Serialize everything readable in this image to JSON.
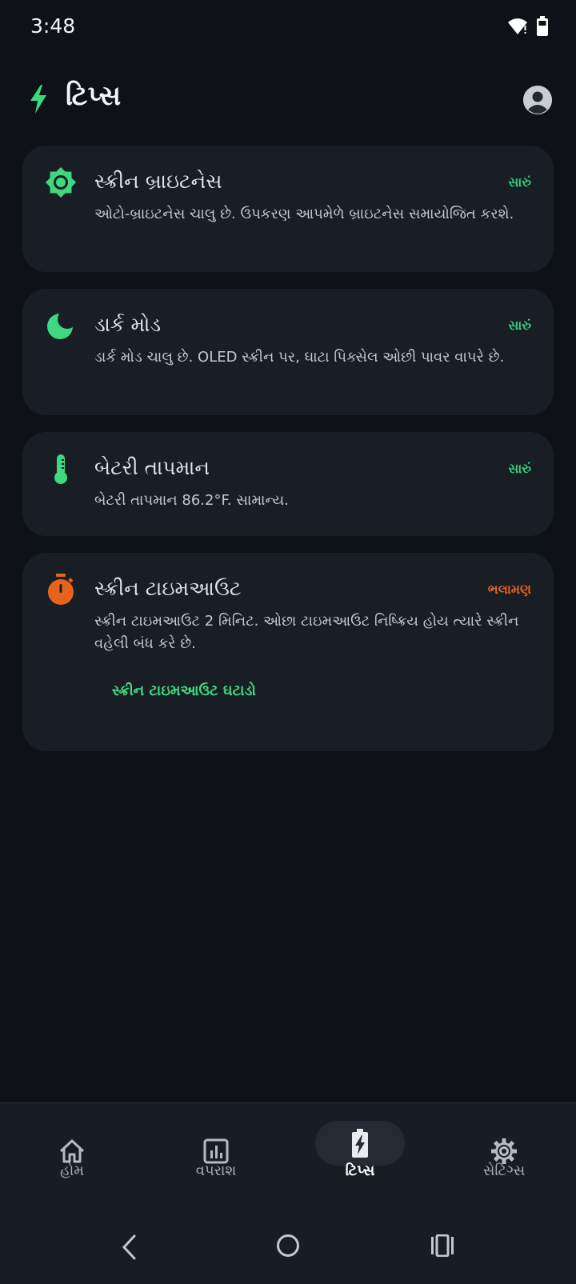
{
  "status_bar": {
    "time": "3:48",
    "icons": [
      "wifi-icon",
      "battery-icon"
    ]
  },
  "header": {
    "title": "ટિપ્સ",
    "icon": "bolt-icon",
    "profile_icon": "account-icon"
  },
  "tips": [
    {
      "icon": "brightness-icon",
      "title": "સ્ક્રીન બ્રાઇટનેસ",
      "badge": "સારું",
      "description": "ઓટો-બ્રાઇટનેસ ચાલુ છે. ઉપકરણ આપમેળે બ્રાઇટનેસ સમાયોજિત કરશે."
    },
    {
      "icon": "moon-icon",
      "title": "ડાર્ક મોડ",
      "badge": "સારું",
      "description": "ડાર્ક મોડ ચાલુ છે. OLED સ્ક્રીન પર, ઘાટા પિક્સેલ ઓછી પાવર વાપરે છે."
    },
    {
      "icon": "thermometer-icon",
      "title": "બેટરી તાપમાન",
      "badge": "સારું",
      "description": "બેટરી તાપમાન 86.2°F. સામાન્ય."
    },
    {
      "icon": "timer-icon",
      "title": "સ્ક્રીન ટાઇમઆઉટ",
      "badge": "ભલામણ",
      "description": "સ્ક્રીન ટાઇમઆઉટ 2 મિનિટ. ઓછા ટાઇમઆઉટ નિષ્ક્રિય હોય ત્યારે સ્ક્રીન વહેલી બંધ કરે છે.",
      "action": "સ્ક્રીન ટાઇમઆઉટ ઘટાડો"
    }
  ],
  "bottom_nav": [
    {
      "label": "હોમ",
      "icon": "home-icon"
    },
    {
      "label": "વપરાશ",
      "icon": "usage-chart-icon"
    },
    {
      "label": "ટિપ્સ",
      "icon": "battery-bolt-icon",
      "active": true
    },
    {
      "label": "સેટિંગ્સ",
      "icon": "gear-icon"
    }
  ],
  "system_nav": [
    "back-icon",
    "home-circle-icon",
    "recents-icon"
  ],
  "colors": {
    "background": "#0e1116",
    "card": "#191e25",
    "accent_good": "#35d07f",
    "accent_recommend": "#e8621c",
    "nav_bar": "#181d24"
  }
}
